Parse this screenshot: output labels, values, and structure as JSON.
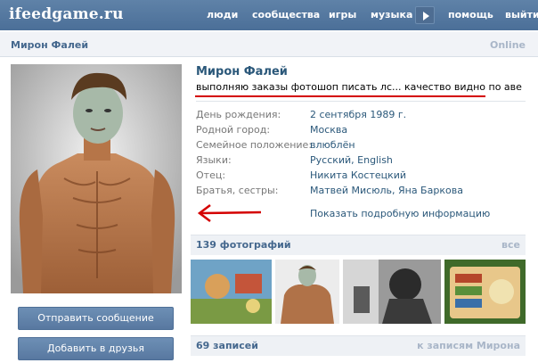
{
  "topbar": {
    "logo": "ifeedgame.ru",
    "nav": [
      "люди",
      "сообщества",
      "игры",
      "музыка",
      "помощь",
      "выйти"
    ]
  },
  "header": {
    "name": "Мирон Фалей",
    "online": "Online"
  },
  "profile": {
    "name": "Мирон Фалей",
    "status": "выполняю заказы фотошоп писать лс... качество видно по аве",
    "info": [
      {
        "label": "День рождения:",
        "value": "2 сентября 1989 г."
      },
      {
        "label": "Родной город:",
        "value": "Москва"
      },
      {
        "label": "Семейное положение:",
        "value": "влюблён"
      },
      {
        "label": "Языки:",
        "value": "Русский, English"
      },
      {
        "label": "Отец:",
        "value": "Никита Костецкий"
      },
      {
        "label": "Братья, сестры:",
        "value": "Матвей Мисюль, Яна Баркова"
      }
    ],
    "more_link": "Показать подробную информацию"
  },
  "buttons": {
    "send_message": "Отправить сообщение",
    "add_friend": "Добавить в друзья"
  },
  "photos": {
    "title": "139 фотографий",
    "all": "все"
  },
  "posts": {
    "title": "69 записей",
    "link": "к записям Мирона"
  },
  "colors": {
    "topbar": "#4b6f98",
    "link": "#2b587a",
    "annotation": "#d40000"
  }
}
